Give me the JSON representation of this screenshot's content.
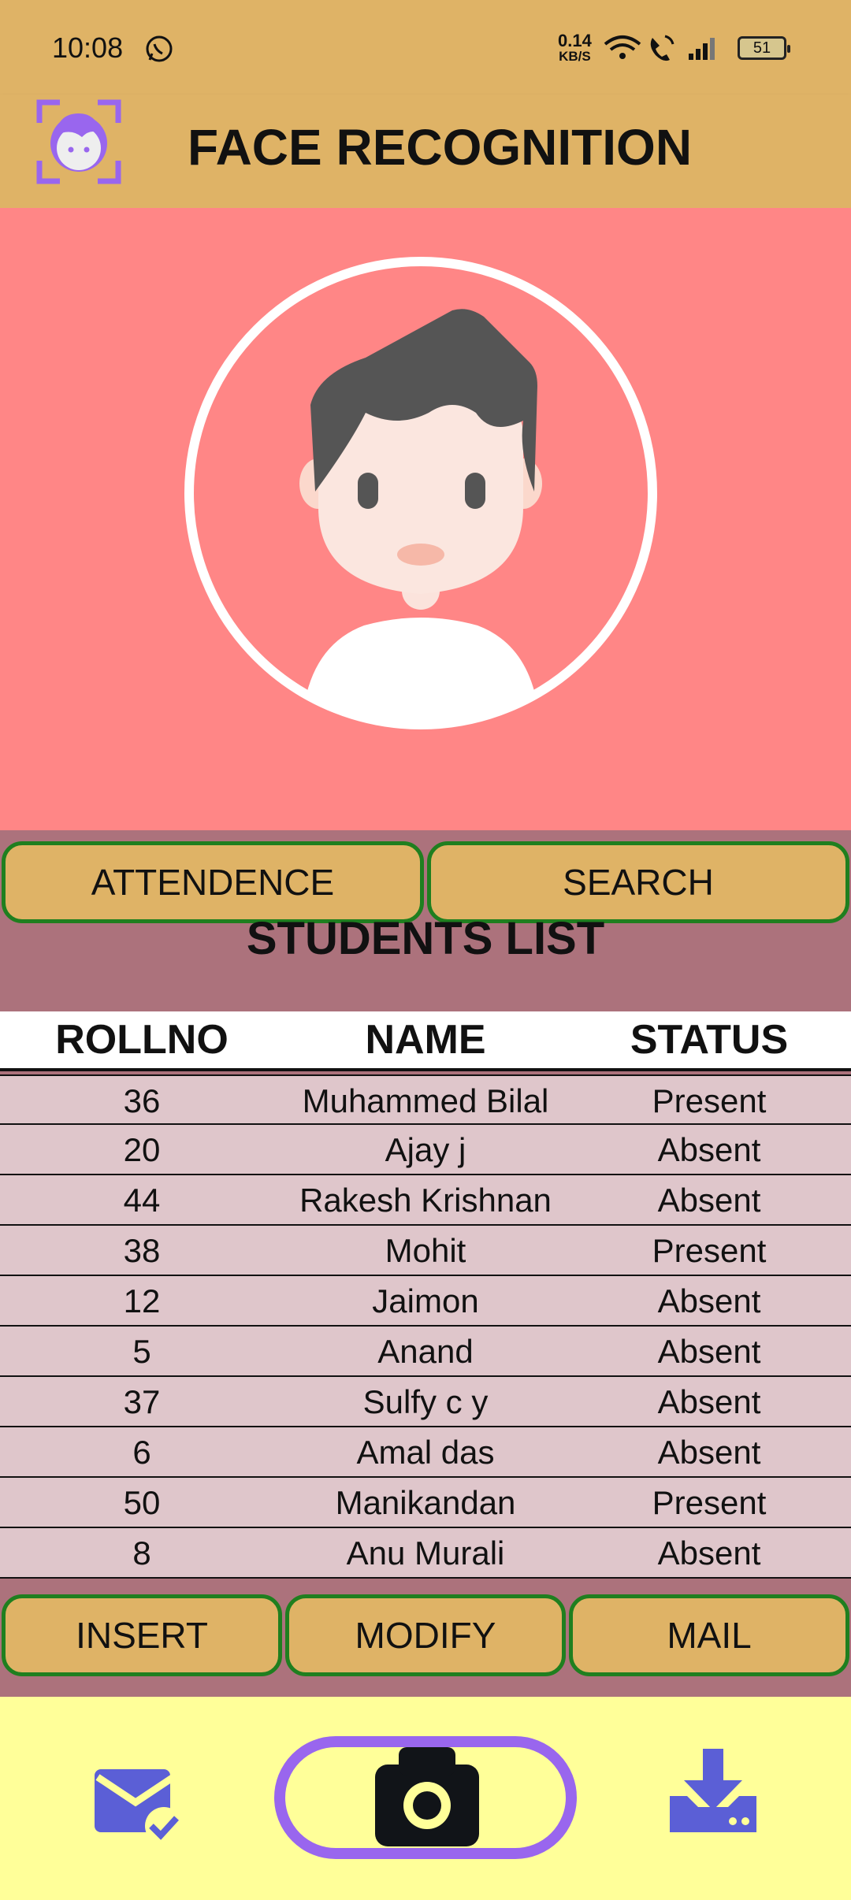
{
  "status_bar": {
    "time": "10:08",
    "net_speed_value": "0.14",
    "net_speed_unit": "KB/S",
    "battery": "51"
  },
  "app_bar": {
    "title": "FACE RECOGNITION",
    "logo_icon": "face-scan-icon"
  },
  "hero": {
    "avatar_icon": "user-avatar-icon"
  },
  "actions": {
    "attendence": "ATTENDENCE",
    "search": "SEARCH"
  },
  "students": {
    "title": "STUDENTS LIST",
    "columns": [
      "ROLLNO",
      "NAME",
      "STATUS"
    ],
    "rows": [
      {
        "rollno": "36",
        "name": "Muhammed Bilal",
        "status": "Present"
      },
      {
        "rollno": "20",
        "name": "Ajay j",
        "status": "Absent"
      },
      {
        "rollno": "44",
        "name": "Rakesh Krishnan",
        "status": "Absent"
      },
      {
        "rollno": "38",
        "name": "Mohit",
        "status": "Present"
      },
      {
        "rollno": "12",
        "name": "Jaimon",
        "status": "Absent"
      },
      {
        "rollno": "5",
        "name": "Anand",
        "status": "Absent"
      },
      {
        "rollno": "37",
        "name": "Sulfy c y",
        "status": "Absent"
      },
      {
        "rollno": "6",
        "name": "Amal das",
        "status": "Absent"
      },
      {
        "rollno": "50",
        "name": "Manikandan",
        "status": "Present"
      },
      {
        "rollno": "8",
        "name": "Anu Murali",
        "status": "Absent"
      }
    ]
  },
  "crud": {
    "insert": "INSERT",
    "modify": "MODIFY",
    "mail": "MAIL"
  },
  "bottom_nav": {
    "items": [
      "mail-check-icon",
      "camera-icon",
      "download-icon"
    ]
  },
  "colors": {
    "header": "#dfb366",
    "hero": "#ff8686",
    "panel": "#ac727c",
    "row": "#dfc6cb",
    "button_border": "#1f7f1f",
    "nav": "#ffff99",
    "accent": "#9966ee"
  }
}
